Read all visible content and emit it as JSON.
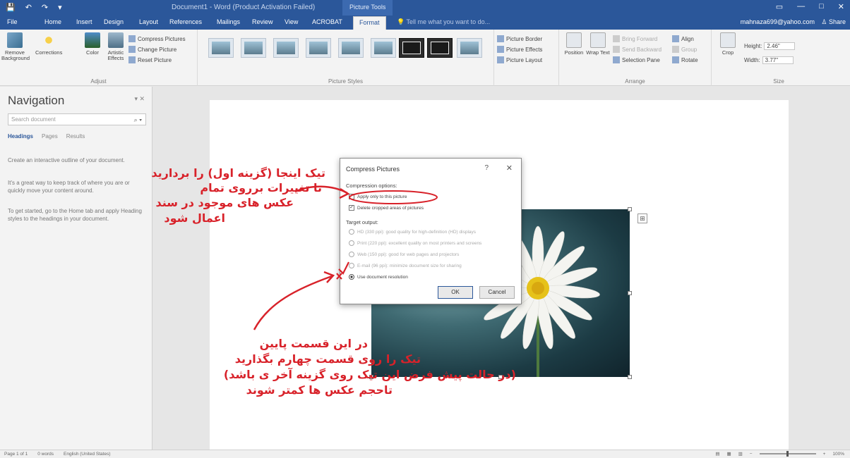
{
  "titlebar": {
    "title": "Document1 - Word (Product Activation Failed)",
    "context_tab": "Picture Tools",
    "qat": [
      "💾",
      "↶",
      "↷",
      "▾"
    ],
    "window_buttons": [
      "▭",
      "—",
      "□",
      "✕"
    ]
  },
  "tabs": [
    "File",
    "Home",
    "Insert",
    "Design",
    "Layout",
    "References",
    "Mailings",
    "Review",
    "View",
    "ACROBAT",
    "Format"
  ],
  "tell_me": "Tell me what you want to do...",
  "user": "mahnaza699@yahoo.com",
  "share": "Share",
  "ribbon": {
    "adjust": {
      "label": "Adjust",
      "remove_bg": "Remove Background",
      "corrections": "Corrections",
      "color": "Color",
      "artistic": "Artistic Effects",
      "compress": "Compress Pictures",
      "change": "Change Picture",
      "reset": "Reset Picture"
    },
    "styles_label": "Picture Styles",
    "picture_border": "Picture Border",
    "picture_effects": "Picture Effects",
    "picture_layout": "Picture Layout",
    "arrange": {
      "label": "Arrange",
      "position": "Position",
      "wrap": "Wrap Text",
      "bring": "Bring Forward",
      "send": "Send Backward",
      "selection": "Selection Pane",
      "align": "Align",
      "group": "Group",
      "rotate": "Rotate"
    },
    "size": {
      "label": "Size",
      "crop": "Crop",
      "height_label": "Height:",
      "height_value": "2.46\"",
      "width_label": "Width:",
      "width_value": "3.77\""
    }
  },
  "nav": {
    "title": "Navigation",
    "search_placeholder": "Search document",
    "tabs": [
      "Headings",
      "Pages",
      "Results"
    ],
    "p1": "Create an interactive outline of your document.",
    "p2": "It's a great way to keep track of where you are or quickly move your content around.",
    "p3": "To get started, go to the Home tab and apply Heading styles to the headings in your document."
  },
  "dialog": {
    "title": "Compress Pictures",
    "help": "?",
    "close": "✕",
    "section1": "Compression options:",
    "opt1": "Apply only to this picture",
    "opt2": "Delete cropped areas of pictures",
    "section2": "Target output:",
    "target": [
      "HD (330 ppi): good quality for high-definition (HD) displays",
      "Print (220 ppi): excellent quality on most printers and screens",
      "Web (150 ppi): good for web pages and projectors",
      "E-mail (96 ppi): minimize document size for sharing",
      "Use document resolution"
    ],
    "ok": "OK",
    "cancel": "Cancel"
  },
  "status": {
    "page": "Page 1 of 1",
    "words": "0 words",
    "lang": "English (United States)",
    "zoom": "100%"
  },
  "annotations": {
    "a1": [
      "تیک اینجا (گزینه اول) را بردارید",
      "تا تغییرات برروی تمام",
      "عکس های موجود در سند",
      "اعمال شود"
    ],
    "a2": [
      "در این قسمت پایین",
      "تیک را روی قسمت چهارم بگذارید",
      "(در حالت پیش فرض این تیک روی گزینه آخر ی باشد)",
      "تاحجم عکس ها کمتر شوند"
    ]
  },
  "colors": {
    "title_blue": "#2b579a",
    "annotation_red": "#d8222a"
  }
}
